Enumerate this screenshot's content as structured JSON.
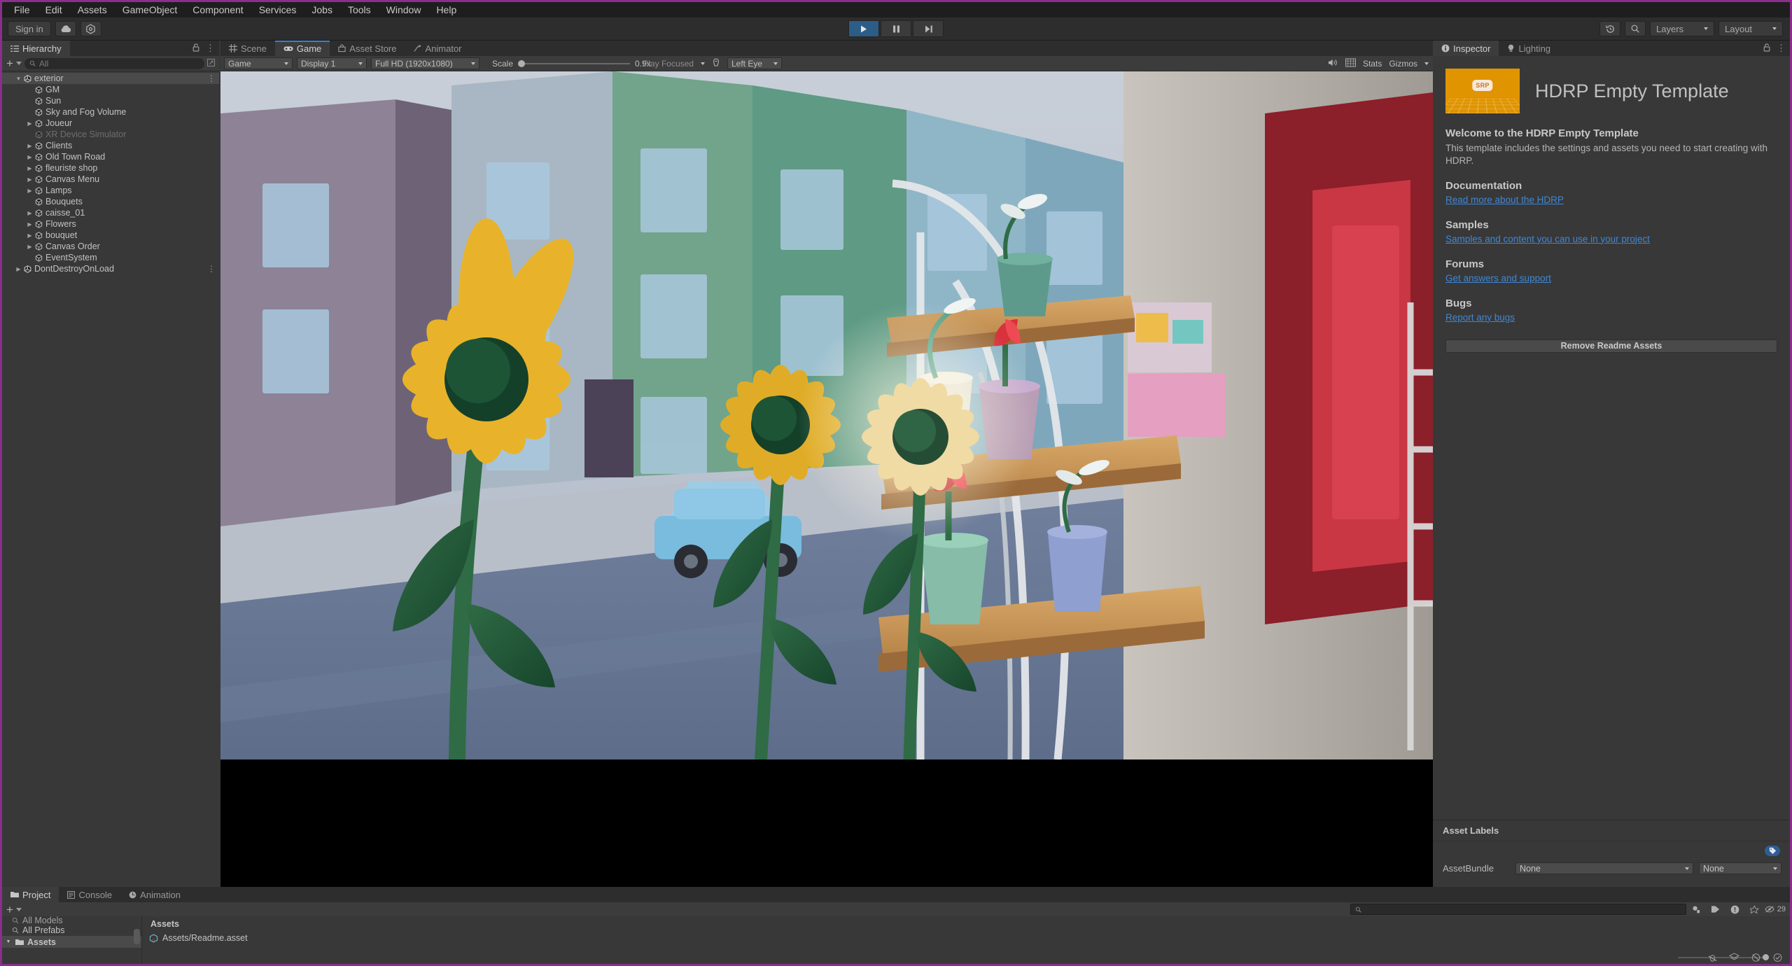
{
  "menubar": {
    "items": [
      "File",
      "Edit",
      "Assets",
      "GameObject",
      "Component",
      "Services",
      "Jobs",
      "Tools",
      "Window",
      "Help"
    ]
  },
  "toolbar": {
    "sign_in": "Sign in",
    "cloud_icon": "cloud-icon",
    "services_icon": "unity-services-icon",
    "play": "play-icon",
    "pause": "pause-icon",
    "step": "step-icon",
    "history_icon": "history-icon",
    "search_icon": "search-icon",
    "layers": "Layers",
    "layout": "Layout",
    "accent_play": "#2c5d87",
    "playmode_border": "#8b2f8b"
  },
  "hierarchy": {
    "tab": "Hierarchy",
    "tab_icon": "hierarchy-icon",
    "lock_icon": "lock-icon",
    "menu_icon": "kebab-icon",
    "plus": "+",
    "search_placeholder": "All",
    "search_icon": "search-icon",
    "items": [
      {
        "label": "exterior",
        "depth": 0,
        "foldout": "open",
        "icon": "unity-scene-icon",
        "selected": true,
        "dim": false,
        "kebab": true
      },
      {
        "label": "GM",
        "depth": 1,
        "foldout": "none",
        "icon": "gameobject-icon",
        "selected": false,
        "dim": false
      },
      {
        "label": "Sun",
        "depth": 1,
        "foldout": "none",
        "icon": "gameobject-icon",
        "selected": false,
        "dim": false
      },
      {
        "label": "Sky and Fog Volume",
        "depth": 1,
        "foldout": "none",
        "icon": "gameobject-icon",
        "selected": false,
        "dim": false
      },
      {
        "label": "Joueur",
        "depth": 1,
        "foldout": "closed",
        "icon": "gameobject-icon",
        "selected": false,
        "dim": false
      },
      {
        "label": "XR Device Simulator",
        "depth": 1,
        "foldout": "none",
        "icon": "gameobject-icon",
        "selected": false,
        "dim": true
      },
      {
        "label": "Clients",
        "depth": 1,
        "foldout": "closed",
        "icon": "gameobject-icon",
        "selected": false,
        "dim": false
      },
      {
        "label": "Old Town Road",
        "depth": 1,
        "foldout": "closed",
        "icon": "gameobject-icon",
        "selected": false,
        "dim": false
      },
      {
        "label": "fleuriste shop",
        "depth": 1,
        "foldout": "closed",
        "icon": "gameobject-icon",
        "selected": false,
        "dim": false
      },
      {
        "label": "Canvas Menu",
        "depth": 1,
        "foldout": "closed",
        "icon": "gameobject-icon",
        "selected": false,
        "dim": false
      },
      {
        "label": "Lamps",
        "depth": 1,
        "foldout": "closed",
        "icon": "gameobject-icon",
        "selected": false,
        "dim": false
      },
      {
        "label": "Bouquets",
        "depth": 1,
        "foldout": "none",
        "icon": "gameobject-icon",
        "selected": false,
        "dim": false
      },
      {
        "label": "caisse_01",
        "depth": 1,
        "foldout": "closed",
        "icon": "gameobject-icon",
        "selected": false,
        "dim": false
      },
      {
        "label": "Flowers",
        "depth": 1,
        "foldout": "closed",
        "icon": "gameobject-icon",
        "selected": false,
        "dim": false
      },
      {
        "label": "bouquet",
        "depth": 1,
        "foldout": "closed",
        "icon": "gameobject-icon",
        "selected": false,
        "dim": false
      },
      {
        "label": "Canvas Order",
        "depth": 1,
        "foldout": "closed",
        "icon": "gameobject-icon",
        "selected": false,
        "dim": false
      },
      {
        "label": "EventSystem",
        "depth": 1,
        "foldout": "none",
        "icon": "gameobject-icon",
        "selected": false,
        "dim": false
      },
      {
        "label": "DontDestroyOnLoad",
        "depth": 0,
        "foldout": "closed",
        "icon": "unity-scene-icon",
        "selected": false,
        "dim": false,
        "kebab": true
      }
    ]
  },
  "gameview": {
    "tabs": [
      {
        "label": "Scene",
        "icon": "scene-grid-icon",
        "active": false
      },
      {
        "label": "Game",
        "icon": "gamepad-icon",
        "active": true
      },
      {
        "label": "Asset Store",
        "icon": "asset-store-icon",
        "active": false
      },
      {
        "label": "Animator",
        "icon": "animator-icon",
        "active": false
      }
    ],
    "toolbar": {
      "view_mode": "Game",
      "display": "Display 1",
      "resolution": "Full HD (1920x1080)",
      "scale_label": "Scale",
      "scale_value": "0.9x",
      "play_focused": "Play Focused",
      "vr_device_icon": "vr-device-icon",
      "eye": "Left Eye",
      "mute_icon": "audio-icon",
      "aspect_icon": "frame-debug-icon",
      "stats": "Stats",
      "gizmos": "Gizmos",
      "maximize_icon": "maximize-icon"
    },
    "scene_description": "Third-person 3D low-poly florist street scene: sunflowers in foreground, blue-green buildings, a light-blue car on the road, and a wooden shelving rack with potted tulips on the right."
  },
  "inspector": {
    "tabs": [
      {
        "label": "Inspector",
        "icon": "info-icon",
        "active": true
      },
      {
        "label": "Lighting",
        "icon": "light-bulb-icon",
        "active": false
      }
    ],
    "lock_icon": "lock-icon",
    "menu_icon": "kebab-icon",
    "readme": {
      "banner_icon_text": "SRP",
      "banner_color": "#e09400",
      "title": "HDRP Empty Template",
      "sections": [
        {
          "heading": "Welcome to the HDRP Empty Template",
          "body": "This template includes the settings and assets you need to start creating with HDRP.",
          "link": ""
        },
        {
          "heading": "Documentation",
          "body": "",
          "link": "Read more about the HDRP"
        },
        {
          "heading": "Samples",
          "body": "",
          "link": "Samples and content you can use in your project"
        },
        {
          "heading": "Forums",
          "body": "",
          "link": "Get answers and support"
        },
        {
          "heading": "Bugs",
          "body": "",
          "link": "Report any bugs"
        }
      ],
      "remove_button": "Remove Readme Assets",
      "link_color": "#3f87d6"
    },
    "asset_labels": {
      "title": "Asset Labels",
      "tag_icon": "tag-icon",
      "bundle_label": "AssetBundle",
      "bundle_value": "None",
      "variant_value": "None"
    }
  },
  "project": {
    "tabs": [
      {
        "label": "Project",
        "icon": "folder-icon",
        "active": true
      },
      {
        "label": "Console",
        "icon": "console-icon",
        "active": false
      },
      {
        "label": "Animation",
        "icon": "animation-icon",
        "active": false
      }
    ],
    "plus": "+",
    "search_placeholder": "",
    "search_icon": "search-icon",
    "tree": [
      {
        "label": "All Models",
        "icon": "search-icon",
        "selected": false,
        "foldout": "none",
        "clipped": true
      },
      {
        "label": "All Prefabs",
        "icon": "search-icon",
        "selected": false,
        "foldout": "none",
        "clipped": false
      },
      {
        "label": "Assets",
        "icon": "folder-icon",
        "selected": true,
        "foldout": "open",
        "clipped": false
      }
    ],
    "breadcrumb": "Assets",
    "asset_row": {
      "label": "Assets/Readme.asset",
      "icon": "scriptable-object-icon"
    },
    "footer_icons": [
      "favorites-icon",
      "label-icon",
      "warning-icon",
      "star-icon"
    ],
    "hidden_count": "29",
    "hidden_icon": "hidden-eye-icon",
    "status_icons": [
      "no-bug-icon",
      "layers-icon",
      "no-collab-icon",
      "check-icon"
    ]
  }
}
